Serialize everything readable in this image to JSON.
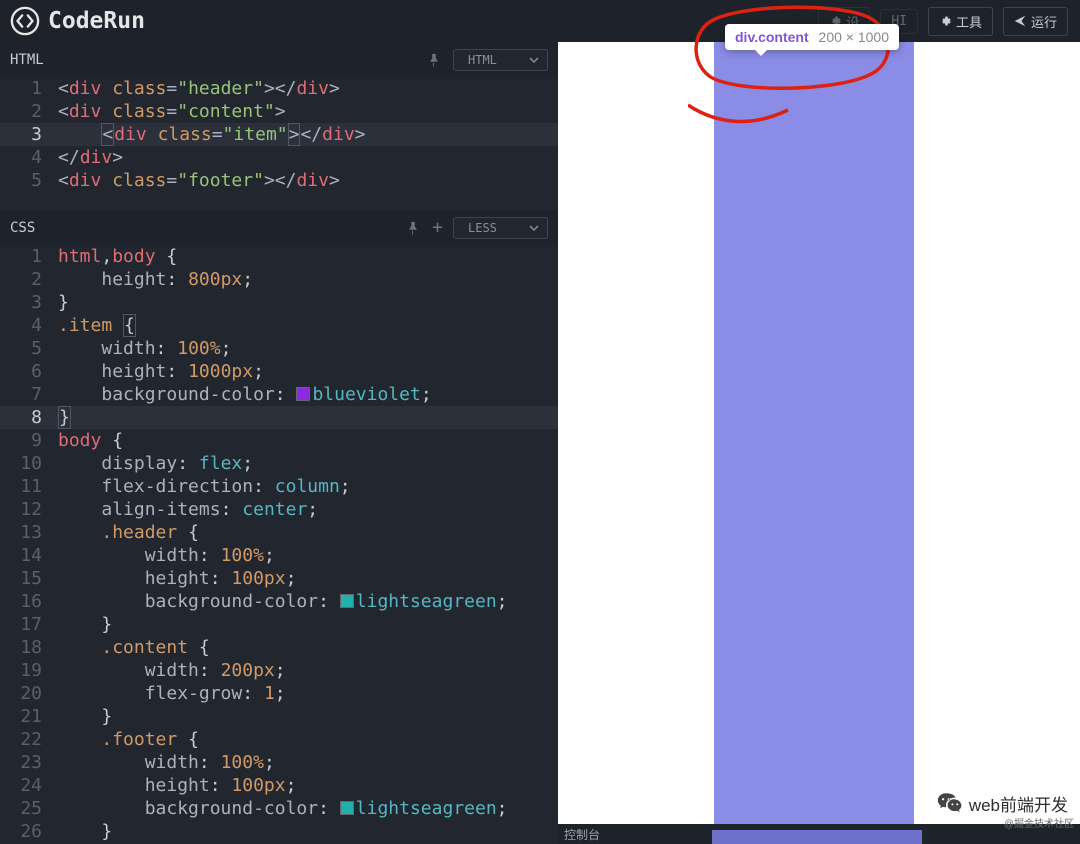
{
  "app": {
    "name": "CodeRun"
  },
  "toolbar": {
    "hidden1": "设",
    "hidden2": "HI",
    "tools": "工具",
    "run": "运行"
  },
  "tooltip": {
    "selector": "div.content",
    "dims": "200 × 1000"
  },
  "panels": {
    "html": {
      "title": "HTML",
      "lang": "HTML"
    },
    "css": {
      "title": "CSS",
      "lang": "LESS"
    }
  },
  "html_code": {
    "l1": {
      "open": "<",
      "tag": "div",
      "attr": "class",
      "eq": "=",
      "val": "\"header\"",
      "close": ">",
      "open2": "</",
      "tag2": "div",
      "close2": ">"
    },
    "l2": {
      "open": "<",
      "tag": "div",
      "attr": "class",
      "eq": "=",
      "val": "\"content\"",
      "close": ">"
    },
    "l3": {
      "open": "<",
      "tag": "div",
      "attr": "class",
      "eq": "=",
      "val": "\"item\"",
      "close": ">",
      "open2": "</",
      "tag2": "div",
      "close2": ">"
    },
    "l4": {
      "open": "</",
      "tag": "div",
      "close": ">"
    },
    "l5": {
      "open": "<",
      "tag": "div",
      "attr": "class",
      "eq": "=",
      "val": "\"footer\"",
      "close": ">",
      "open2": "</",
      "tag2": "div",
      "close2": ">"
    }
  },
  "css_code": {
    "l1": "html,body {",
    "l2p": "height",
    "l2v": "800px",
    "l3": "}",
    "l4": ".item {",
    "l5p": "width",
    "l5v": "100%",
    "l6p": "height",
    "l6v": "1000px",
    "l7p": "background-color",
    "l7v": "blueviolet",
    "l8": "}",
    "l9": "body {",
    "l10p": "display",
    "l10v": "flex",
    "l11p": "flex-direction",
    "l11v": "column",
    "l12p": "align-items",
    "l12v": "center",
    "l13": ".header {",
    "l14p": "width",
    "l14v": "100%",
    "l15p": "height",
    "l15v": "100px",
    "l16p": "background-color",
    "l16v": "lightseagreen",
    "l17": "}",
    "l18": ".content {",
    "l19p": "width",
    "l19v": "200px",
    "l20p": "flex-grow",
    "l20v": "1",
    "l21": "}",
    "l22": ".footer {",
    "l23p": "width",
    "l23v": "100%",
    "l24p": "height",
    "l24v": "100px",
    "l25p": "background-color",
    "l25v": "lightseagreen",
    "l26": "}"
  },
  "gutters": {
    "html": [
      "1",
      "2",
      "3",
      "4",
      "5"
    ],
    "css": [
      "1",
      "2",
      "3",
      "4",
      "5",
      "6",
      "7",
      "8",
      "9",
      "10",
      "11",
      "12",
      "13",
      "14",
      "15",
      "16",
      "17",
      "18",
      "19",
      "20",
      "21",
      "22",
      "23",
      "24",
      "25",
      "26"
    ]
  },
  "colors": {
    "blueviolet": "#8a2be2",
    "lightseagreen": "#20b2aa"
  },
  "preview": {
    "console_label": "控制台"
  },
  "overlay": {
    "wechat": "web前端开发",
    "credit": "@掘金技术社区"
  }
}
